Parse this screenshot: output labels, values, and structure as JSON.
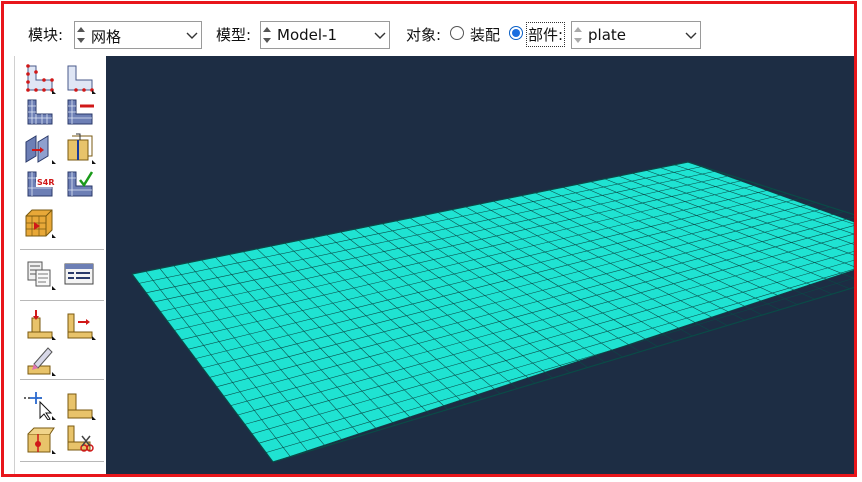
{
  "toolbar": {
    "module_label": "模块:",
    "module_value": "网格",
    "model_label": "模型:",
    "model_value": "Model-1",
    "object_label": "对象:",
    "assembly_label": "装配",
    "part_label": "部件:",
    "part_value": "plate",
    "selected_object": "part"
  },
  "toolbox": {
    "tools": [
      "seed-part-icon",
      "seed-edges-icon",
      "mesh-part-icon",
      "delete-mesh-icon",
      "assign-mesh-controls-icon",
      "partition-cell-icon",
      "assign-element-type-icon",
      "verify-mesh-icon",
      "create-virtual-topology-icon",
      "query-icon",
      "mesh-stats-icon",
      "edit-mesh-icon",
      "mesh-edit-edge-icon",
      "repair-mesh-icon",
      "query-selection-icon",
      "create-datum-icon",
      "partition-face-icon",
      "remove-mesh-icon"
    ]
  },
  "viewport": {
    "mesh_face_color": "#1fe3d2",
    "mesh_line_color": "#0a4a47",
    "background_color": "#1d2d44"
  }
}
